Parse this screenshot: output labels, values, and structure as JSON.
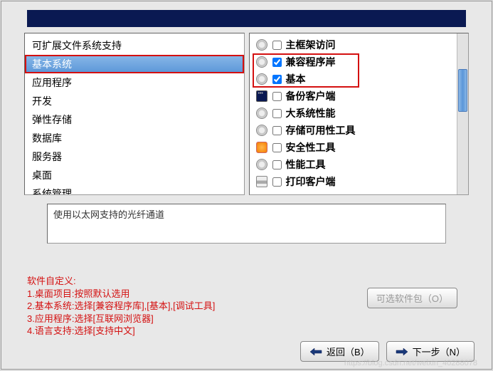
{
  "categories": [
    {
      "label": "可扩展文件系统支持",
      "selected": false
    },
    {
      "label": "基本系统",
      "selected": true,
      "highlighted": true
    },
    {
      "label": "应用程序",
      "selected": false
    },
    {
      "label": "开发",
      "selected": false
    },
    {
      "label": "弹性存储",
      "selected": false
    },
    {
      "label": "数据库",
      "selected": false
    },
    {
      "label": "服务器",
      "selected": false
    },
    {
      "label": "桌面",
      "selected": false
    },
    {
      "label": "系统管理",
      "selected": false
    }
  ],
  "packages": [
    {
      "icon": "gear",
      "checked": false,
      "label": "主框架访问"
    },
    {
      "icon": "gear",
      "checked": true,
      "label": "兼容程序岸"
    },
    {
      "icon": "gear",
      "checked": true,
      "label": "基本"
    },
    {
      "icon": "blue",
      "checked": false,
      "label": "备份客户端"
    },
    {
      "icon": "gear",
      "checked": false,
      "label": "大系统性能"
    },
    {
      "icon": "gear",
      "checked": false,
      "label": "存储可用性工具"
    },
    {
      "icon": "orange",
      "checked": false,
      "label": "安全性工具"
    },
    {
      "icon": "gear",
      "checked": false,
      "label": "性能工具"
    },
    {
      "icon": "printer",
      "checked": false,
      "label": "打印客户端"
    }
  ],
  "description": "使用以太网支持的光纤通道",
  "instructions": {
    "title": "软件自定义:",
    "line1": "1.桌面项目:按照默认选用",
    "line2": "2.基本系统:选择[兼容程序库],[基本],[调试工具]",
    "line3": "3.应用程序:选择[互联网浏览器]",
    "line4": "4.语言支持:选择[支持中文]"
  },
  "buttons": {
    "optional": "可选软件包（O）",
    "back": "返回（B）",
    "next": "下一步（N）"
  },
  "watermark": "https://blog.csdn.net/weixin_40288078"
}
